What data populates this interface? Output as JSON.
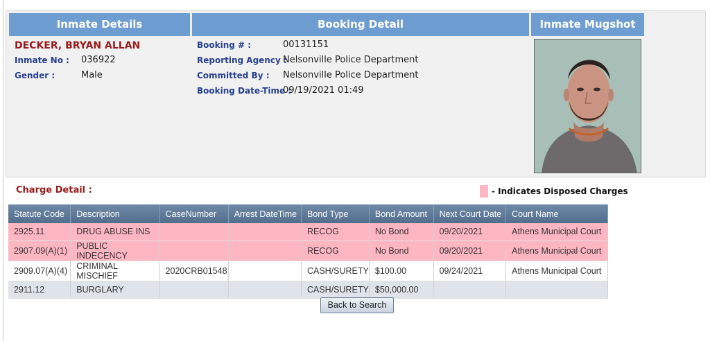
{
  "inmate": {
    "header": "Inmate Details",
    "name": "DECKER, BRYAN ALLAN",
    "inmate_no_label": "Inmate No :",
    "inmate_no": "036922",
    "gender_label": "Gender :",
    "gender": "Male"
  },
  "booking": {
    "header": "Booking Detail",
    "booking_no_label": "Booking # :",
    "booking_no": "00131151",
    "agency_label": "Reporting Agency :",
    "agency": "Nelsonville Police Department",
    "committed_label": "Committed By :",
    "committed": "Nelsonville Police Department",
    "datetime_label": "Booking Date-Time :",
    "datetime": "09/19/2021 01:49"
  },
  "mugshot": {
    "header": "Inmate Mugshot"
  },
  "charges": {
    "title": "Charge Detail :",
    "legend": "- Indicates Disposed Charges",
    "legend_color": "#ffb6c3",
    "columns": [
      "Statute Code",
      "Description",
      "CaseNumber",
      "Arrest DateTime",
      "Bond Type",
      "Bond Amount",
      "Next Court Date",
      "Court Name"
    ],
    "rows": [
      {
        "style": "disposed",
        "cells": [
          "2925.11",
          "DRUG ABUSE INS",
          "",
          "",
          "RECOG",
          "No Bond",
          "09/20/2021",
          "Athens Municipal Court"
        ]
      },
      {
        "style": "disposed",
        "cells": [
          "2907.09(A)(1)",
          "PUBLIC INDECENCY",
          "",
          "",
          "RECOG",
          "No Bond",
          "09/20/2021",
          "Athens Municipal Court"
        ]
      },
      {
        "style": "plain",
        "cells": [
          "2909.07(A)(4)",
          "CRIMINAL MISCHIEF",
          "2020CRB01548",
          "",
          "CASH/SURETY",
          "$100.00",
          "09/24/2021",
          "Athens Municipal Court"
        ]
      },
      {
        "style": "alt",
        "cells": [
          "2911.12",
          "BURGLARY",
          "",
          "",
          "CASH/SURETY",
          "$50,000.00",
          "",
          ""
        ]
      }
    ]
  },
  "back_button": "Back to Search"
}
